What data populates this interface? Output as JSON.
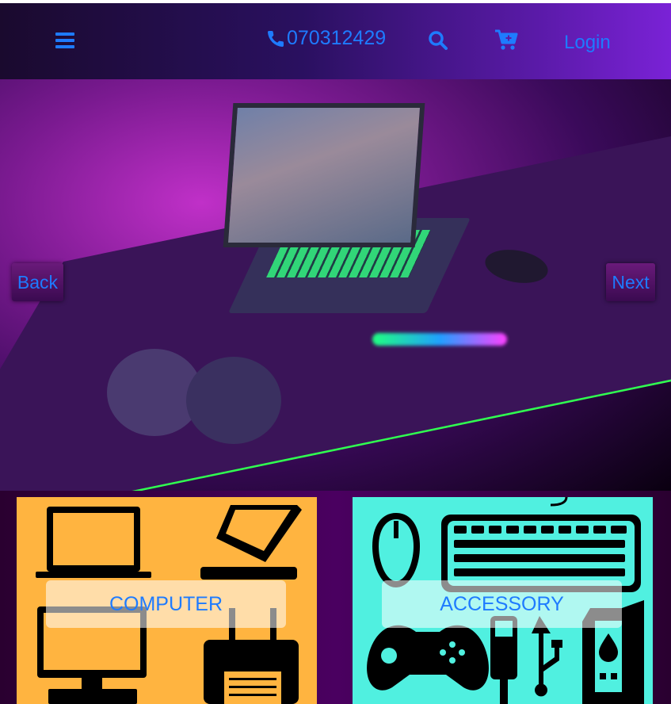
{
  "header": {
    "menu_icon": "hamburger-icon",
    "phone_icon": "phone-icon",
    "phone": "070312429",
    "search_icon": "search-icon",
    "cart_icon": "cart-plus-icon",
    "login_label": "Login",
    "accent_color": "#1e7bff"
  },
  "hero": {
    "back_label": "Back",
    "next_label": "Next"
  },
  "categories": [
    {
      "label": "COMPUTER",
      "color": "#ffb440"
    },
    {
      "label": "ACCESSORY",
      "color": "#50f0e0"
    }
  ]
}
